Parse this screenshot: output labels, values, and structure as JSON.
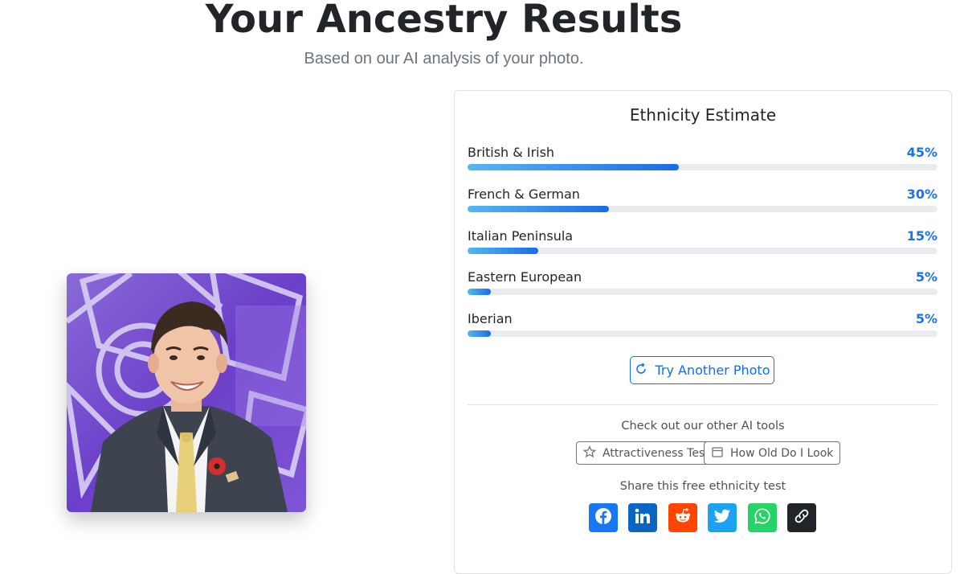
{
  "header": {
    "title": "Your Ancestry Results",
    "subtitle": "Based on our AI analysis of your photo."
  },
  "results": {
    "heading": "Ethnicity Estimate",
    "items": [
      {
        "label": "British & Irish",
        "percent_text": "45%",
        "value": 0.45
      },
      {
        "label": "French & German",
        "percent_text": "30%",
        "value": 0.3
      },
      {
        "label": "Italian Peninsula",
        "percent_text": "15%",
        "value": 0.15
      },
      {
        "label": "Eastern European",
        "percent_text": "5%",
        "value": 0.05
      },
      {
        "label": "Iberian",
        "percent_text": "5%",
        "value": 0.05
      }
    ],
    "try_again_label": "Try Another Photo"
  },
  "tools": {
    "heading": "Check out our other AI tools",
    "attractiveness_label": "Attractiveness Test",
    "age_label": "How Old Do I Look"
  },
  "share": {
    "heading": "Share this free ethnicity test",
    "buttons": [
      {
        "icon": "facebook-icon",
        "color": "#1877f2"
      },
      {
        "icon": "linkedin-icon",
        "color": "#0a66c2"
      },
      {
        "icon": "reddit-icon",
        "color": "#ff4500"
      },
      {
        "icon": "twitter-icon",
        "color": "#1da1f2"
      },
      {
        "icon": "whatsapp-icon",
        "color": "#25d366"
      },
      {
        "icon": "copy-link-icon",
        "color": "#212529"
      }
    ]
  },
  "colors": {
    "accent": "#0d6efd",
    "percent_text": "#1a73e8",
    "bar_track": "#e9ecef"
  }
}
